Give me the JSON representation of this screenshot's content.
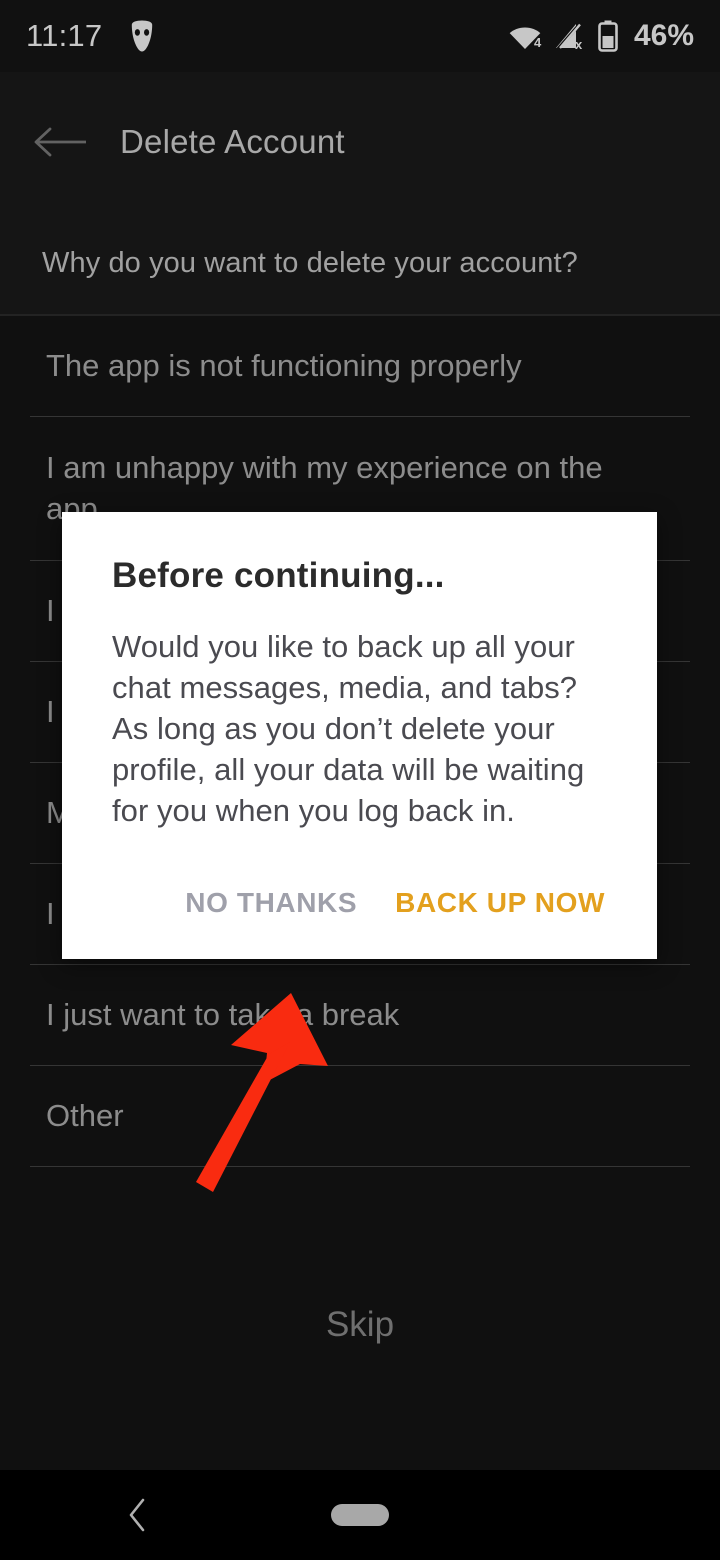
{
  "status_bar": {
    "time": "11:17",
    "app_icon": "grindr-mask-icon",
    "wifi_icon": "wifi-icon",
    "wifi_badge": "4",
    "signal_icon": "cellular-signal-no-service-icon",
    "battery_icon": "battery-icon",
    "battery_percent": "46%"
  },
  "app_bar": {
    "back_icon": "back-arrow-icon",
    "title": "Delete Account"
  },
  "question": {
    "text": "Why do you want to delete your account?"
  },
  "reasons": [
    {
      "label": "The app is not functioning properly"
    },
    {
      "label": "I am unhappy with my experience on the app"
    },
    {
      "label": "I am taking a break from dating apps"
    },
    {
      "label": "I want to create a new profile"
    },
    {
      "label": "My account has been hacked"
    },
    {
      "label": "I prefer another dating app"
    },
    {
      "label": "I just want to take a break"
    },
    {
      "label": "Other"
    }
  ],
  "skip": {
    "label": "Skip"
  },
  "dialog": {
    "title": "Before continuing...",
    "message": "Would you like to back up all your chat messages, media, and tabs? As long as you don’t delete your profile, all your data will be waiting for you when you log back in.",
    "buttons": {
      "secondary": "NO THANKS",
      "primary": "BACK UP NOW"
    }
  },
  "annotation": {
    "arrow_icon": "red-pointer-arrow",
    "arrow_color": "#f92b10",
    "points_at": "NO THANKS"
  },
  "nav_bar": {
    "back_icon": "nav-back-chevron-icon",
    "home_indicator": "home-pill-indicator"
  },
  "colors": {
    "background": "#151515",
    "app_bar_background": "#1b1b1b",
    "divider": "#454545",
    "primary_text": "#b4b4b4",
    "dialog_background": "#ffffff",
    "accent_orange": "#e3a01e",
    "secondary_button": "#9fa0aa"
  }
}
